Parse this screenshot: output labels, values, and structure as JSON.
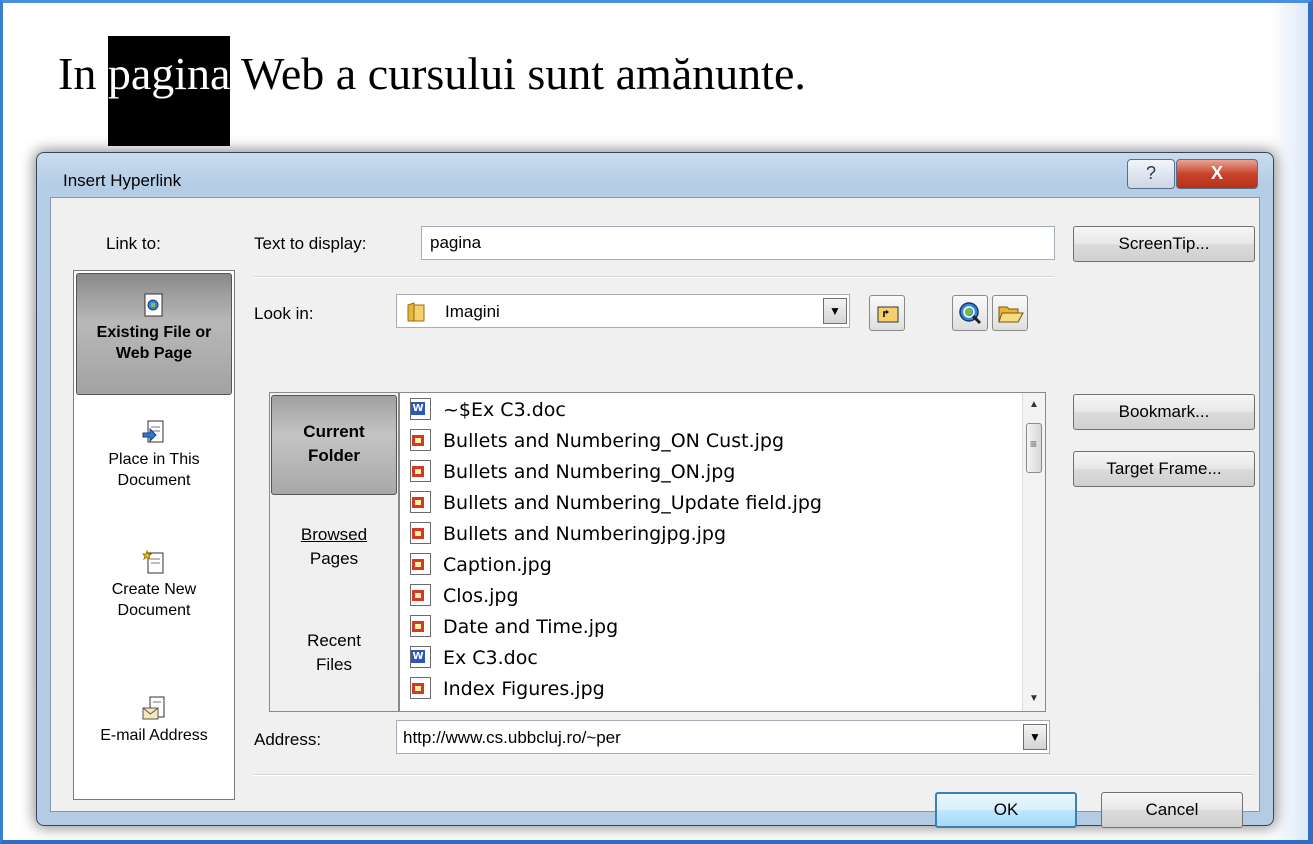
{
  "slide": {
    "heading_before": "In ",
    "heading_selected": "pagina",
    "heading_after": " Web a cursului sunt amănunte."
  },
  "dialog": {
    "title": "Insert Hyperlink",
    "help_glyph": "?",
    "close_glyph": "X",
    "link_to_label": "Link to:",
    "link_to_items": [
      {
        "line1": "Existing File or",
        "line2": "Web Page",
        "icon": "web-file-icon"
      },
      {
        "line1": "Place in This",
        "line2": "Document",
        "icon": "place-in-document-icon"
      },
      {
        "line1": "Create New",
        "line2": "Document",
        "icon": "new-document-icon"
      },
      {
        "line1": "E-mail Address",
        "line2": "",
        "icon": "email-icon"
      }
    ],
    "text_to_display_label": "Text to display:",
    "text_to_display_value": "pagina",
    "screentip_label": "ScreenTip...",
    "look_in_label": "Look in:",
    "look_in_value": "Imagini",
    "places": [
      {
        "line1": "Current",
        "line2": "Folder"
      },
      {
        "line1": "Browsed",
        "line2": "Pages"
      },
      {
        "line1": "Recent",
        "line2": "Files"
      }
    ],
    "files": [
      {
        "name": "~$Ex C3.doc",
        "type": "doc"
      },
      {
        "name": "Bullets and Numbering_ON Cust.jpg",
        "type": "jpg"
      },
      {
        "name": "Bullets and Numbering_ON.jpg",
        "type": "jpg"
      },
      {
        "name": "Bullets and Numbering_Update field.jpg",
        "type": "jpg"
      },
      {
        "name": "Bullets and Numberingjpg.jpg",
        "type": "jpg"
      },
      {
        "name": "Caption.jpg",
        "type": "jpg"
      },
      {
        "name": "Clos.jpg",
        "type": "jpg"
      },
      {
        "name": "Date and Time.jpg",
        "type": "jpg"
      },
      {
        "name": "Ex C3.doc",
        "type": "doc"
      },
      {
        "name": "Index Figures.jpg",
        "type": "jpg"
      }
    ],
    "bookmark_label": "Bookmark...",
    "target_frame_label": "Target Frame...",
    "address_label": "Address:",
    "address_value": "http://www.cs.ubbcluj.ro/~per",
    "ok_label": "OK",
    "cancel_label": "Cancel"
  }
}
